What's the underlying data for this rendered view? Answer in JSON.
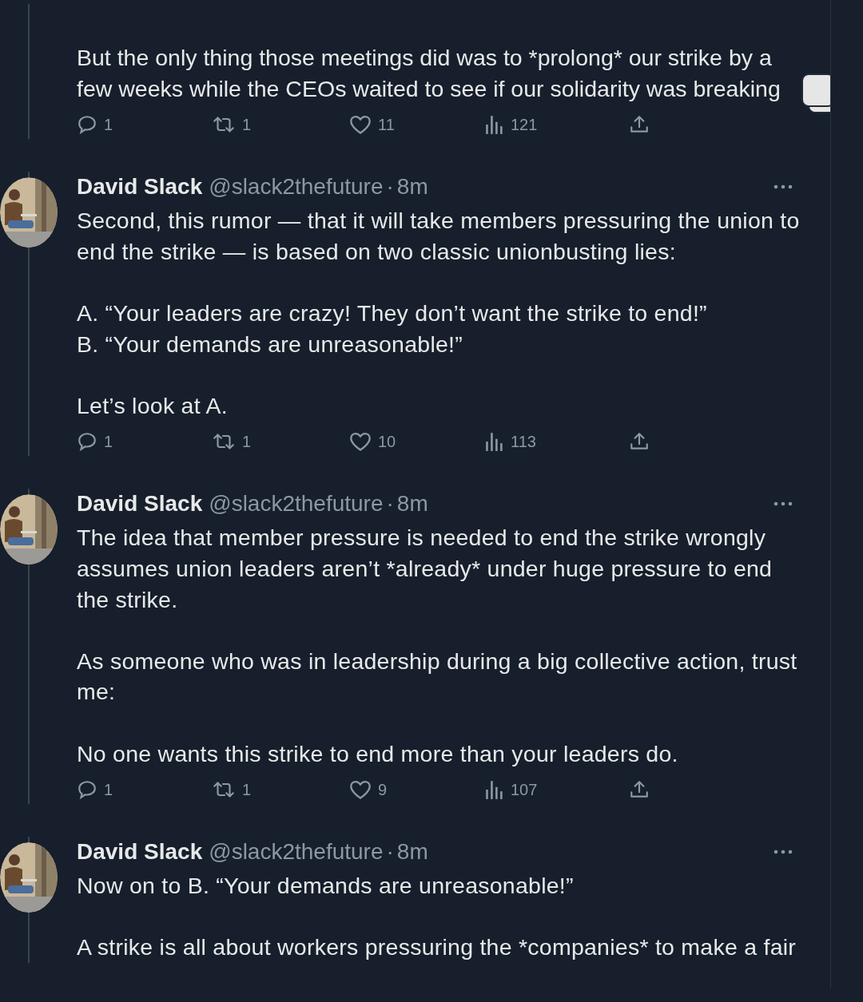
{
  "tweets": [
    {
      "paragraphs": [
        "But the only thing those meetings did was to *prolong* our strike by a few weeks while the CEOs waited to see if our solidarity was breaking"
      ],
      "stats": {
        "replies": "1",
        "reposts": "1",
        "likes": "11",
        "views": "121"
      }
    },
    {
      "author": {
        "name": "David Slack",
        "handle": "@slack2thefuture",
        "separator": "·",
        "time": "8m"
      },
      "paragraphs": [
        "Second, this rumor — that it will take members pressuring the union to end the strike — is based on two classic unionbusting lies:",
        "A. “Your leaders are crazy! They don’t want the strike to end!”\nB. “Your demands are unreasonable!”",
        "Let’s look at A."
      ],
      "stats": {
        "replies": "1",
        "reposts": "1",
        "likes": "10",
        "views": "113"
      }
    },
    {
      "author": {
        "name": "David Slack",
        "handle": "@slack2thefuture",
        "separator": "·",
        "time": "8m"
      },
      "paragraphs": [
        "The idea that member pressure is needed to end the strike wrongly assumes union leaders aren’t *already* under huge pressure to end the strike.",
        "As someone who was in leadership during a big collective action, trust me:",
        "No one wants this strike to end more than your leaders do."
      ],
      "stats": {
        "replies": "1",
        "reposts": "1",
        "likes": "9",
        "views": "107"
      }
    },
    {
      "author": {
        "name": "David Slack",
        "handle": "@slack2thefuture",
        "separator": "·",
        "time": "8m"
      },
      "paragraphs": [
        "Now on to B. “Your demands are unreasonable!”",
        "A strike is all about workers pressuring the *companies* to make a fair"
      ]
    }
  ]
}
